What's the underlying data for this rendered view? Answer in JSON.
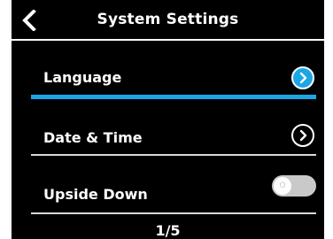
{
  "header": {
    "title": "System Settings",
    "back_icon": "chevron-left-icon"
  },
  "settings": [
    {
      "label": "Language",
      "control": "chevron-right-icon",
      "selected": true
    },
    {
      "label": "Date & Time",
      "control": "chevron-right-icon",
      "selected": false
    },
    {
      "label": "Upside Down",
      "control": "toggle",
      "toggle_state": "off",
      "toggle_knob_text": "O"
    }
  ],
  "pager": {
    "text": "1/5"
  },
  "colors": {
    "background": "#000000",
    "accent": "#1aa7e6",
    "text": "#ffffff",
    "toggle_off": "#c9c9c9",
    "divider": "#d8d8d8"
  }
}
